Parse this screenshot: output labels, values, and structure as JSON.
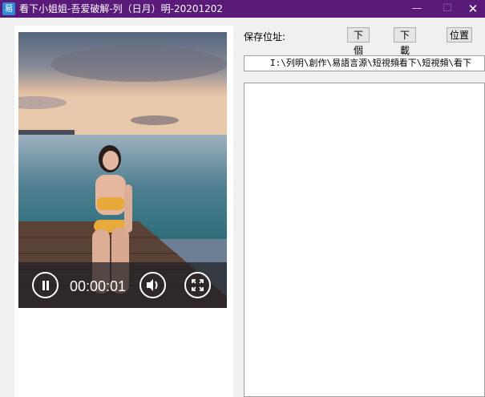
{
  "window": {
    "title": "看下小姐姐-吾爱破解-列（日月）明-20201202",
    "icon": "易",
    "minimize_glyph": "—",
    "maximize_glyph": "☐",
    "close_glyph": "✕"
  },
  "player": {
    "time": "00:00:01",
    "icons": [
      "pause-icon",
      "volume-icon",
      "fullscreen-icon"
    ]
  },
  "right": {
    "save_label": "保存位址:",
    "next_button": "下個",
    "download_button": "下載",
    "location_button": "位置",
    "path_value": "I:\\列明\\創作\\易語言源\\短視頻看下\\短視頻\\看下"
  },
  "colors": {
    "titlebar": "#5a1a7a",
    "accent_icon": "#2f8bd6"
  }
}
